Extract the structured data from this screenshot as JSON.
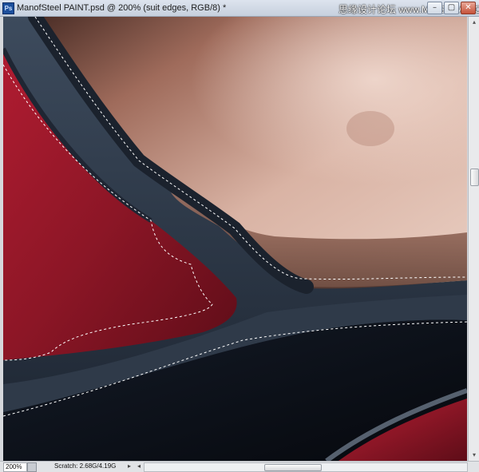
{
  "window": {
    "title": "ManofSteel PAINT.psd @ 200% (suit edges, RGB/8) *",
    "app_icon": "Ps",
    "controls": {
      "minimize": "–",
      "restore": "▢",
      "close": "✕"
    }
  },
  "watermark": "思缘设计论坛 www.MISSYUAN.COM",
  "status_bar": {
    "zoom": "200%",
    "scratch": "Scratch: 2.68G/4.19G",
    "arrow_right": "▸",
    "arrow_left": "◂"
  },
  "scrollbar": {
    "up": "▴",
    "down": "▾"
  },
  "canvas": {
    "description_icon": "image-canvas",
    "colors": {
      "skin": "#c48d79",
      "red_suit": "#8c1626",
      "dark_suit": "#2b3645",
      "shadow": "#0b0f17"
    }
  }
}
